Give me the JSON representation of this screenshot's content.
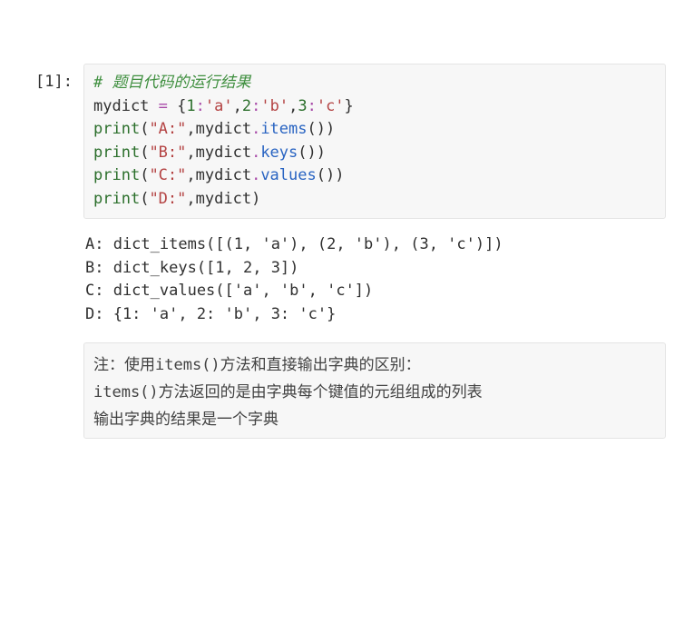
{
  "prompt_label": "[1]:",
  "code": {
    "comment": "# 题目代码的运行结果",
    "var": "mydict",
    "eq": " = ",
    "ob": "{",
    "cb": "}",
    "k1": "1",
    "c1": ":",
    "v1": "'a'",
    "sep1": ",",
    "k2": "2",
    "c2": ":",
    "v2": "'b'",
    "sep2": ",",
    "k3": "3",
    "c3": ":",
    "v3": "'c'",
    "print": "print",
    "op": "(",
    "cp": ")",
    "argA": "\"A:\"",
    "argB": "\"B:\"",
    "argC": "\"C:\"",
    "argD": "\"D:\"",
    "comma": ",",
    "dot": ".",
    "m_items": "items",
    "m_keys": "keys",
    "m_values": "values",
    "pp": "()",
    "id": "mydict"
  },
  "output": {
    "l1": "A: dict_items([(1, 'a'), (2, 'b'), (3, 'c')])",
    "l2": "B: dict_keys([1, 2, 3])",
    "l3": "C: dict_values(['a', 'b', 'c'])",
    "l4": "D: {1: 'a', 2: 'b', 3: 'c'}"
  },
  "note": {
    "l1_a": "注：使用",
    "l1_b": "items()",
    "l1_c": "方法和直接输出字典的区别：",
    "l2_a": "items()",
    "l2_b": "方法返回的是由字典每个键值的元组组成的列表",
    "l3": "输出字典的结果是一个字典"
  }
}
